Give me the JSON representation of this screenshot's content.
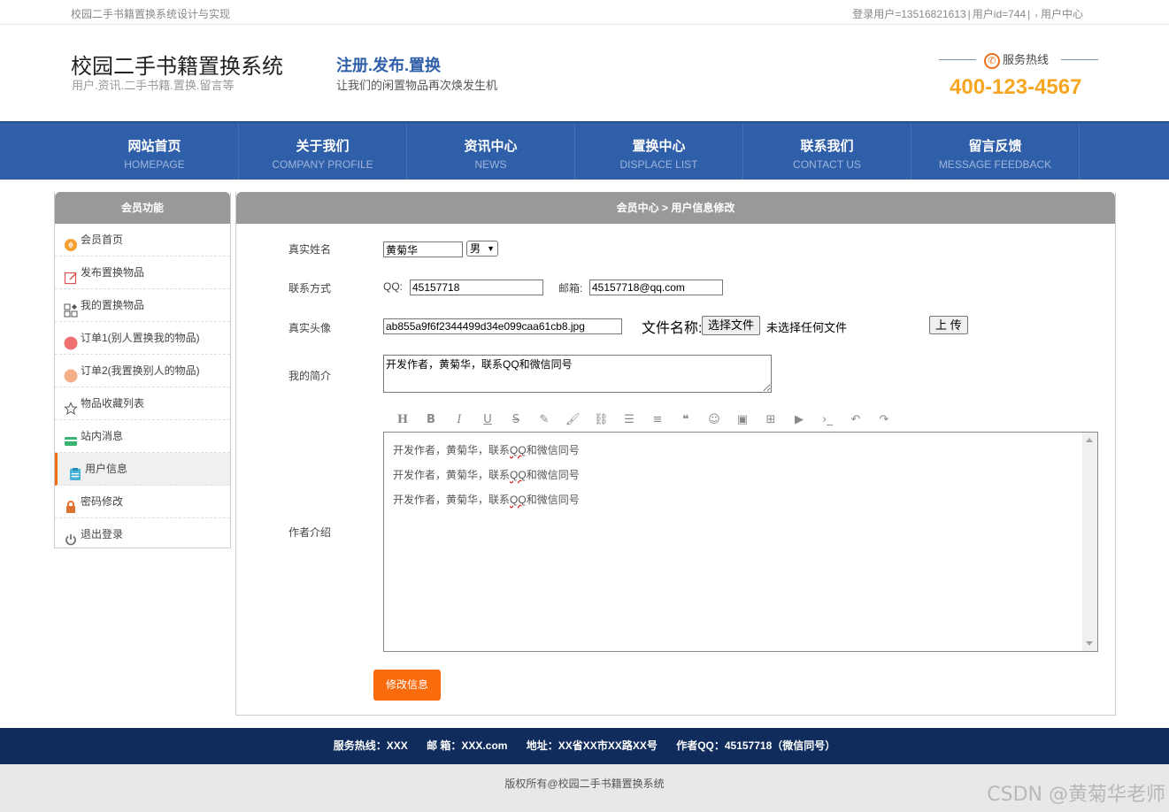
{
  "topbar": {
    "site_desc": "校园二手书籍置换系统设计与实现",
    "login_user": "登录用户=13516821613",
    "user_id": "用户id=744",
    "user_center": "用户中心"
  },
  "header": {
    "title": "校园二手书籍置换系统",
    "subtitle": "用户.资讯.二手书籍.置换.留言等",
    "slogan_title": "注册.发布.置换",
    "slogan_sub": "让我们的闲置物品再次焕发生机",
    "hotline_label": "服务热线",
    "hotline_number": "400-123-4567"
  },
  "nav": [
    {
      "cn": "网站首页",
      "en": "HOMEPAGE"
    },
    {
      "cn": "关于我们",
      "en": "COMPANY PROFILE"
    },
    {
      "cn": "资讯中心",
      "en": "NEWS"
    },
    {
      "cn": "置换中心",
      "en": "DISPLACE LIST"
    },
    {
      "cn": "联系我们",
      "en": "CONTACT US"
    },
    {
      "cn": "留言反馈",
      "en": "MESSAGE FEEDBACK"
    }
  ],
  "sidebar": {
    "title": "会员功能",
    "items": [
      {
        "label": "会员首页",
        "icon": "home-icon"
      },
      {
        "label": "发布置换物品",
        "icon": "edit-icon"
      },
      {
        "label": "我的置换物品",
        "icon": "grid-icon"
      },
      {
        "label": "订单1(别人置换我的物品)",
        "icon": "order-icon"
      },
      {
        "label": "订单2(我置换别人的物品)",
        "icon": "order-alt-icon"
      },
      {
        "label": "物品收藏列表",
        "icon": "star-icon"
      },
      {
        "label": "站内消息",
        "icon": "message-icon"
      },
      {
        "label": "用户信息",
        "icon": "user-info-icon"
      },
      {
        "label": "密码修改",
        "icon": "lock-icon"
      },
      {
        "label": "退出登录",
        "icon": "power-icon"
      }
    ],
    "active_index": 7
  },
  "main": {
    "breadcrumb": "会员中心 > 用户信息修改",
    "labels": {
      "real_name": "真实姓名",
      "contact": "联系方式",
      "avatar": "真实头像",
      "bio": "我的简介",
      "author_intro": "作者介绍"
    },
    "real_name_value": "黄菊华",
    "gender_value": "男",
    "qq_label": "QQ:",
    "qq_value": "45157718",
    "email_label": "邮箱:",
    "email_value": "45157718@qq.com",
    "avatar_value": "ab855a9f6f2344499d34e099caa61cb8.jpg",
    "file_name_label": "文件名称:",
    "choose_file_label": "选择文件",
    "no_file_label": "未选择任何文件",
    "upload_label": "上 传",
    "bio_value": "开发作者，黄菊华，联系QQ和微信同号",
    "editor_lines": [
      {
        "pre": "开发作者，黄菊华，联系",
        "qq": "QQ",
        "post": "和微信同号"
      },
      {
        "pre": "开发作者，黄菊华，联系",
        "qq": "QQ",
        "post": "和微信同号"
      },
      {
        "pre": "开发作者，黄菊华，联系",
        "qq": "QQ",
        "post": "和微信同号"
      }
    ],
    "toolbar_icons": [
      "heading-icon",
      "bold-icon",
      "italic-icon",
      "underline-icon",
      "strikethrough-icon",
      "eraser-icon",
      "brush-icon",
      "link-icon",
      "list-icon",
      "align-icon",
      "quote-icon",
      "emoji-icon",
      "image-icon",
      "table-icon",
      "video-icon",
      "code-icon",
      "undo-icon",
      "redo-icon"
    ],
    "submit_label": "修改信息"
  },
  "footer": {
    "hotline": "服务热线：XXX",
    "email": "邮 箱：XXX.com",
    "address": "地址：XX省XX市XX路XX号",
    "author_qq": "作者QQ：45157718（微信同号）",
    "copyright": "版权所有@校园二手书籍置换系统"
  },
  "watermark": "CSDN @黄菊华老师",
  "colors": {
    "nav_bg": "#2f5fa8",
    "accent_orange": "#f96b0c",
    "hotline_orange": "#f5a623",
    "footer_bg": "#0f2c5c"
  }
}
